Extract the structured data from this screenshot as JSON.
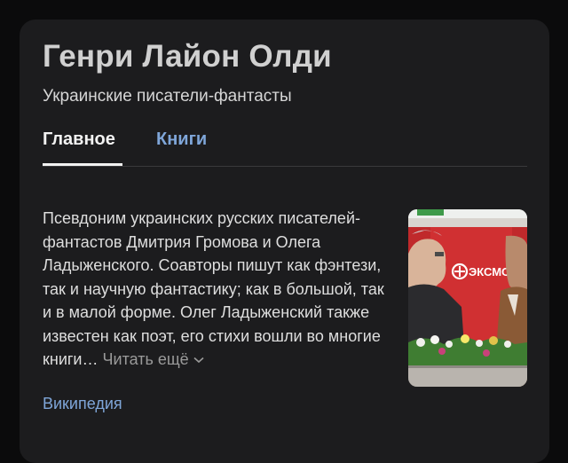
{
  "author": {
    "name": "Генри Лайон Олди",
    "subtitle": "Украинские писатели-фантасты"
  },
  "tabs": [
    {
      "label": "Главное",
      "active": true
    },
    {
      "label": "Книги",
      "active": false
    }
  ],
  "description": {
    "text": "Псевдоним украинских русских писателей-фантастов Дмитрия Громова и Олега Ладыженского. Соавторы пишут как фэнтези, так и научную фантастику; как в большой, так и в малой форме. Олег Ладыженский также известен как поэт, его стихи вошли во многие книги…",
    "more_label": "Читать ещё",
    "more_icon": "chevron-down-icon"
  },
  "source_link": "Википедия",
  "photo": {
    "banner_text": "ЭКСМО",
    "logo_icon": "eksmo-logo-icon"
  },
  "colors": {
    "background": "#0b0b0c",
    "card": "#1c1c1e",
    "link": "#7fa6d9",
    "muted": "#9a9a9a"
  }
}
